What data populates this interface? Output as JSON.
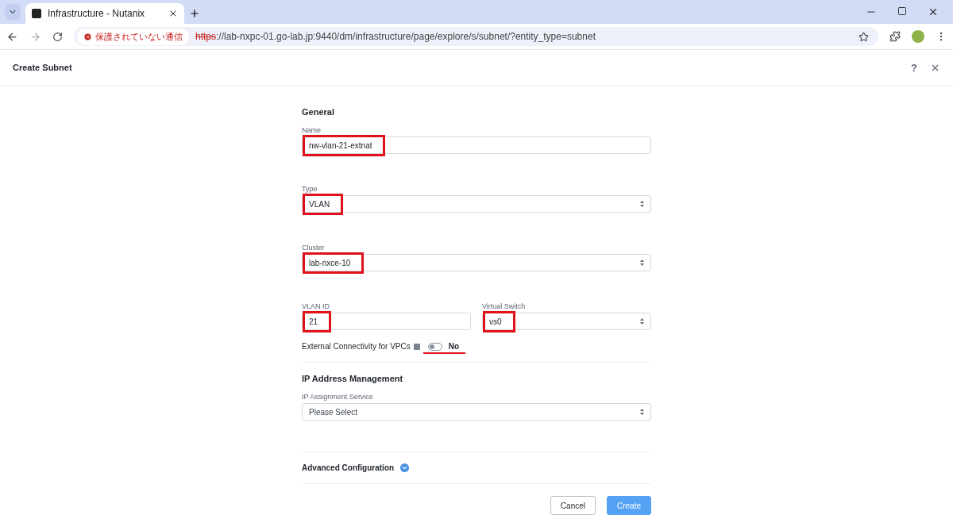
{
  "browser": {
    "tab_title": "Infrastructure - Nutanix",
    "security_label": "保護されていない通信",
    "url_scheme": "https",
    "url_rest": "://lab-nxpc-01.go-lab.jp:9440/dm/infrastructure/page/explore/s/subnet/?entity_type=subnet"
  },
  "dialog": {
    "title": "Create Subnet",
    "help": "?"
  },
  "general": {
    "heading": "General",
    "fields": [
      {
        "kind": "input",
        "label": "Name",
        "value": "nw-vlan-21-extnat",
        "highlighted": true
      },
      {
        "kind": "select",
        "label": "Type",
        "value": "VLAN",
        "highlighted": true
      },
      {
        "kind": "select",
        "label": "Cluster",
        "value": "lab-nxce-10",
        "highlighted": true
      }
    ],
    "pair": [
      {
        "kind": "input",
        "label": "VLAN ID",
        "value": "21",
        "highlighted": true
      },
      {
        "kind": "select",
        "label": "Virtual Switch",
        "value": "vs0",
        "highlighted": true
      }
    ],
    "toggle": {
      "label": "External Connectivity for VPCs",
      "on": false,
      "state_text": "No",
      "underlined": true
    }
  },
  "ipam": {
    "heading": "IP Address Management",
    "fields": [
      {
        "kind": "select",
        "label": "IP Assignment Service",
        "placeholder": "Please Select",
        "highlighted": false
      }
    ]
  },
  "advanced": {
    "heading": "Advanced Configuration",
    "expanded": false
  },
  "buttons": [
    {
      "kind": "secondary",
      "label": "Cancel"
    },
    {
      "kind": "primary",
      "label": "Create"
    }
  ]
}
